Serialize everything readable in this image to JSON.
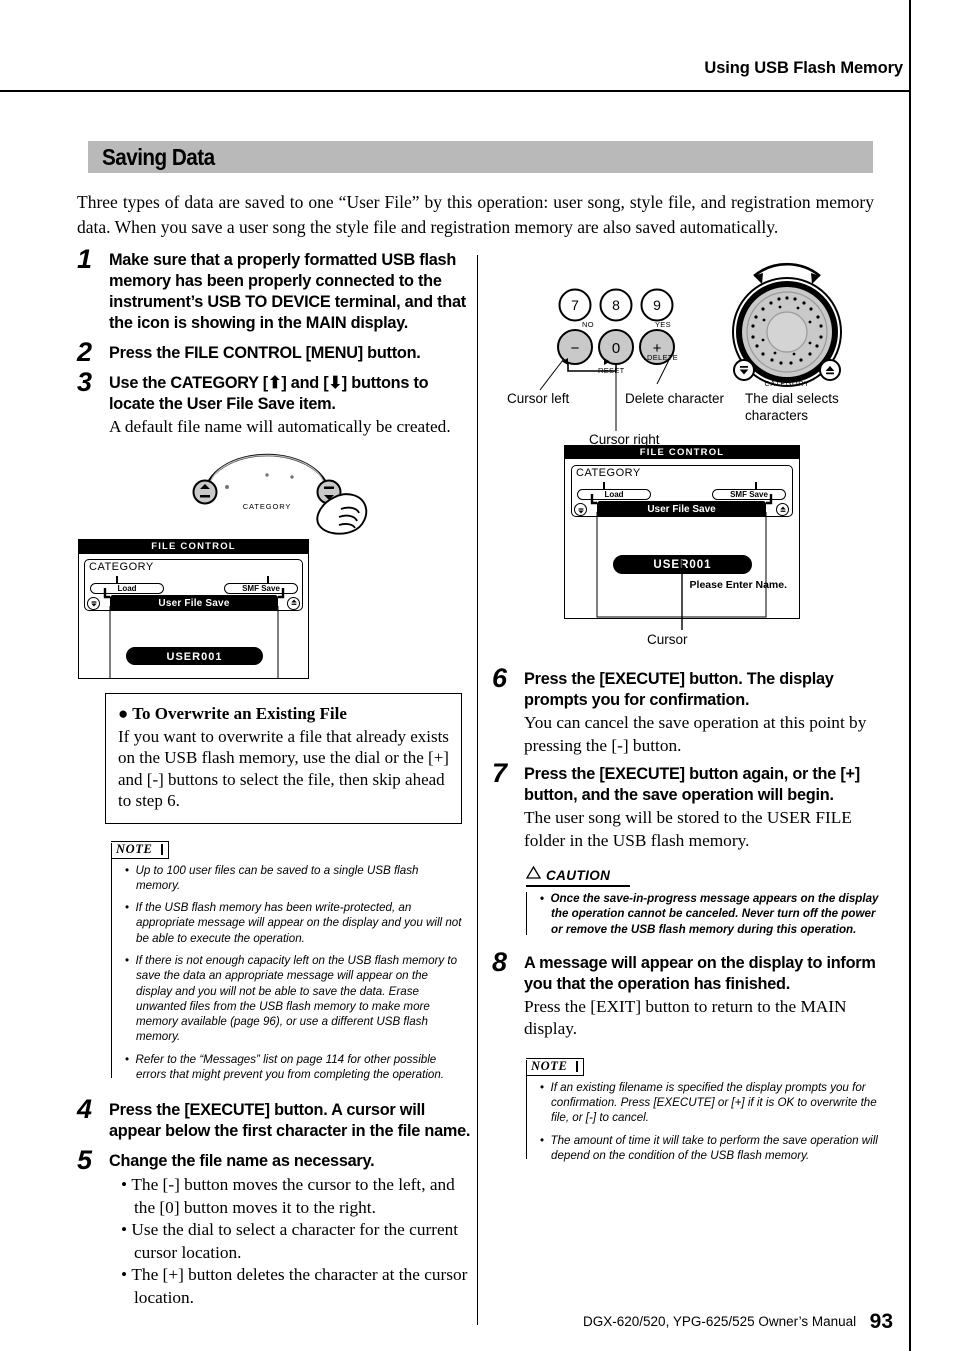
{
  "header": {
    "running_head": "Using USB Flash Memory"
  },
  "section": {
    "title": "Saving Data"
  },
  "intro": "Three types of data are saved to one “User File” by this operation: user song, style file, and registration memory data. When you save a user song the style file and registration memory are also saved automatically.",
  "steps": [
    {
      "num": "1",
      "head": "Make sure that a properly formatted USB flash memory has been properly connected to the instrument’s USB TO DEVICE terminal, and that the icon is showing in the MAIN display."
    },
    {
      "num": "2",
      "head": "Press the FILE CONTROL [MENU] button."
    },
    {
      "num": "3",
      "head": "Use the CATEGORY [⬆] and [⬇] buttons to locate the User File Save item.",
      "body": "A default file name will automatically be created."
    },
    {
      "num": "4",
      "head": "Press the [EXECUTE] button. A cursor will appear below the first character in the file name."
    },
    {
      "num": "5",
      "head": "Change the file name as necessary.",
      "bullets": [
        "The [-] button moves the cursor to the left, and the [0] button moves it to the right.",
        "Use the dial to select a character for the current cursor location.",
        "The [+] button deletes the character at the cursor location."
      ]
    },
    {
      "num": "6",
      "head": "Press the [EXECUTE] button. The display prompts you for confirmation.",
      "body": "You can cancel the save operation at this point by pressing the [-] button."
    },
    {
      "num": "7",
      "head": "Press the [EXECUTE] button again, or the [+] button, and the save operation will begin.",
      "body": "The user song will be stored to the USER FILE folder in the USB flash memory."
    },
    {
      "num": "8",
      "head": "A message will appear on the display to inform you that the operation has finished.",
      "body": "Press the [EXIT] button to return to the MAIN display."
    }
  ],
  "overwrite_box": {
    "title": "To Overwrite an Existing File",
    "text": "If you want to overwrite a file that already exists on the USB flash memory, use the dial or the [+] and [-] buttons to select the file, then skip ahead to step 6."
  },
  "note_left": {
    "label": "NOTE",
    "items": [
      "Up to 100 user files can be saved to a single USB flash memory.",
      "If the USB flash memory has been write-protected, an appropriate message will appear on the display and you will not be able to execute the operation.",
      "If there is not enough capacity left on the USB flash memory to save the data an appropriate message will appear on the display and you will not be able to save the data. Erase unwanted files from the USB flash memory to make more memory available (page 96), or use a different USB flash memory.",
      "Refer to the “Messages” list on page 114 for other possible errors that might prevent you from completing the operation."
    ]
  },
  "caution": {
    "label": "CAUTION",
    "items": [
      "Once the save-in-progress message appears on the display the operation cannot be canceled. Never turn off the power or remove the USB flash memory during this operation."
    ]
  },
  "note_right": {
    "label": "NOTE",
    "items": [
      "If an existing filename is specified the display prompts you for confirmation. Press [EXECUTE] or [+] if it is OK to overwrite the file, or [-] to cancel.",
      "The amount of time it will take to perform the save operation will depend on the condition of the USB flash memory."
    ]
  },
  "lcd_left": {
    "title": "FILE CONTROL",
    "category_label": "CATEGORY",
    "left_item": "Load",
    "right_item": "SMF Save",
    "selected_item": "User File Save",
    "file_name": "USER001"
  },
  "lcd_right": {
    "title": "FILE CONTROL",
    "category_label": "CATEGORY",
    "left_item": "Load",
    "right_item": "SMF Save",
    "selected_item": "User File Save",
    "file_name": "USER001",
    "prompt": "Please Enter Name.",
    "cursor_caption": "Cursor"
  },
  "panel_diagram": {
    "keys_top": [
      "7",
      "8",
      "9"
    ],
    "keys_bottom": [
      "−",
      "0",
      "+"
    ],
    "label_no": "NO",
    "label_yes": "YES",
    "label_delete": "DELETE",
    "label_reset": "RESET",
    "label_category": "CATEGORY",
    "caption_cursor_left": "Cursor left",
    "caption_cursor_right": "Cursor right",
    "caption_delete_character": "Delete character",
    "caption_dial": "The dial selects characters"
  },
  "category_diagram": {
    "label": "CATEGORY"
  },
  "footer": {
    "text": "DGX-620/520, YPG-625/525  Owner’s Manual",
    "page": "93"
  }
}
